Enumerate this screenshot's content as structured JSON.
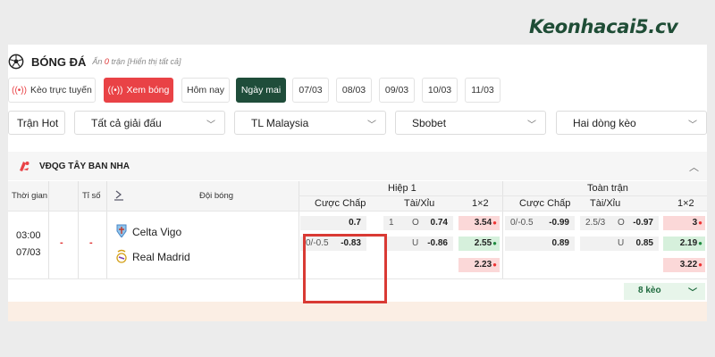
{
  "logo": "Keonhacai5.cv",
  "header": {
    "title": "BÓNG ĐÁ",
    "hidden_prefix": "Ẩn",
    "hidden_count": "0",
    "hidden_suffix": "trận [Hiển thị tất cả]"
  },
  "buttons": [
    {
      "label": "Kèo trực tuyến"
    },
    {
      "label": "Xem bóng"
    },
    {
      "label": "Hôm nay"
    },
    {
      "label": "Ngày mai"
    },
    {
      "label": "07/03"
    },
    {
      "label": "08/03"
    },
    {
      "label": "09/03"
    },
    {
      "label": "10/03"
    },
    {
      "label": "11/03"
    }
  ],
  "filters": {
    "hot": "Trận Hot",
    "league": "Tất cả giải đấu",
    "odds_type": "TL Malaysia",
    "bookmaker": "Sbobet",
    "lines": "Hai dòng kèo"
  },
  "league": {
    "name": "VĐQG TÂY BAN NHA"
  },
  "table": {
    "col_time": "Thời gian",
    "col_score": "Tỉ số",
    "col_team": "Đội bóng",
    "half": "Hiệp 1",
    "full": "Toàn trận",
    "handicap": "Cược Chấp",
    "overunder": "Tài/Xỉu",
    "x12": "1×2"
  },
  "match": {
    "time": "03:00",
    "date": "07/03",
    "score1": "-",
    "score2": "-",
    "home": "Celta Vigo",
    "away": "Real Madrid",
    "half": {
      "hdp_home": "0.7",
      "hdp_line": "0/-0.5",
      "hdp_away": "-0.83",
      "ou_line": "1",
      "ou_o_label": "O",
      "ou_over": "0.74",
      "ou_u_label": "U",
      "ou_under": "-0.86",
      "x1": "3.54",
      "x2": "2.55",
      "xd": "2.23"
    },
    "full": {
      "hdp_line": "0/-0.5",
      "hdp_home": "-0.99",
      "hdp_away": "0.89",
      "ou_line": "2.5/3",
      "ou_o_label": "O",
      "ou_over": "-0.97",
      "ou_u_label": "U",
      "ou_under": "0.85",
      "x1": "3",
      "x2": "2.19",
      "xd": "3.22"
    },
    "more": "8 kèo"
  },
  "colors": {
    "accent_red": "#e94246",
    "accent_green": "#1f4d3a",
    "highlight": "#d93a34"
  }
}
